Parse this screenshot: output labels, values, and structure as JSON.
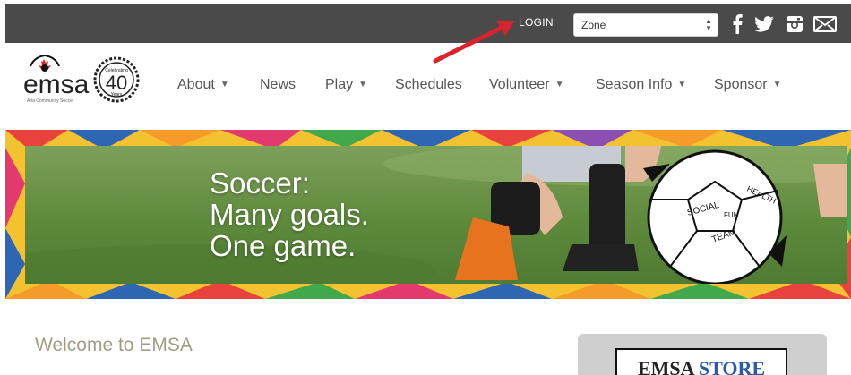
{
  "topbar": {
    "login_label": "LOGIN",
    "zone_value": "Zone",
    "social": [
      "facebook-icon",
      "twitter-icon",
      "instagram-icon",
      "mail-icon"
    ]
  },
  "logo": {
    "name": "emsa",
    "tagline": "Aria Community Soccer",
    "badge_top": "Celebrating",
    "badge_number": "40",
    "badge_bottom": "Years"
  },
  "nav": {
    "items": [
      {
        "label": "About",
        "dropdown": true
      },
      {
        "label": "News",
        "dropdown": false
      },
      {
        "label": "Play",
        "dropdown": true
      },
      {
        "label": "Schedules",
        "dropdown": false
      },
      {
        "label": "Volunteer",
        "dropdown": true
      },
      {
        "label": "Season Info",
        "dropdown": true
      },
      {
        "label": "Sponsor",
        "dropdown": true
      }
    ]
  },
  "banner": {
    "line1": "Soccer:",
    "line2": "Many goals.",
    "line3": "One game.",
    "ball_words": [
      "HEALTH",
      "SOCIAL",
      "FUN",
      "TEAM"
    ]
  },
  "main": {
    "welcome_title": "Welcome to EMSA"
  },
  "sidebar": {
    "store_part1": "EMSA",
    "store_part2": "STORE"
  },
  "colors": {
    "topbar": "#4a4a4a",
    "nav_text": "#555555",
    "welcome_text": "#a39b86",
    "store_accent": "#2a5aa8",
    "annotation_arrow": "#d9232d"
  }
}
